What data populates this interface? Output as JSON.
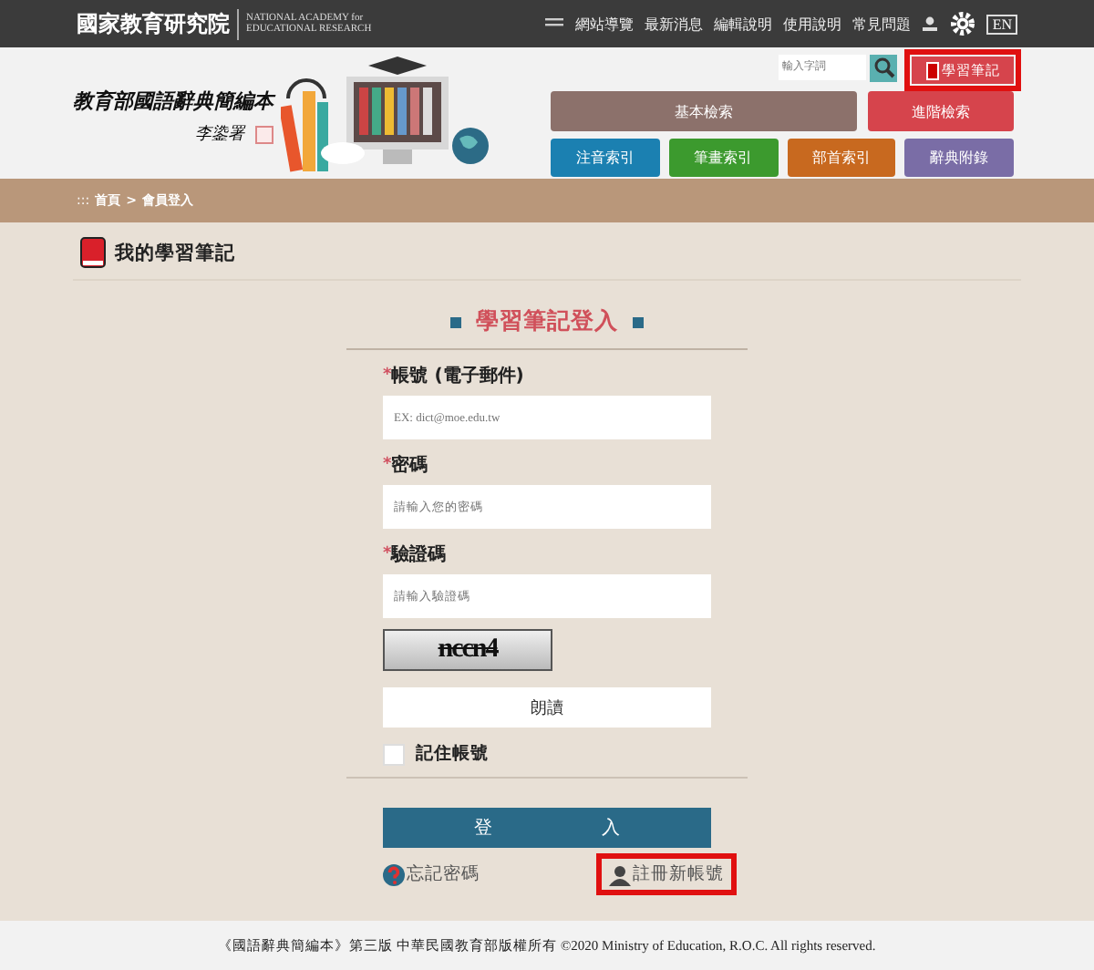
{
  "top_bar": {
    "org_name": "國家教育研究院",
    "org_english": [
      "NATIONAL ACADEMY for",
      "EDUCATIONAL RESEARCH"
    ],
    "nav": [
      "網站導覽",
      "最新消息",
      "編輯說明",
      "使用說明",
      "常見問題"
    ],
    "language": "EN"
  },
  "header": {
    "site_title": "教育部國語辭典簡編本",
    "signature": "李鍌署",
    "search": {
      "placeholder": "輸入字詞"
    },
    "notes_button": {
      "label": "學習筆記",
      "highlighted": true
    },
    "buttons": [
      {
        "label": "基本檢索",
        "color": "#8c716b"
      },
      {
        "label": "進階檢索",
        "color": "#d6444c"
      }
    ],
    "index_buttons": [
      {
        "label": "注音索引",
        "color": "#1b80b1"
      },
      {
        "label": "筆畫索引",
        "color": "#3c9a2e"
      },
      {
        "label": "部首索引",
        "color": "#c8691f"
      },
      {
        "label": "辭典附錄",
        "color": "#7a6da6"
      }
    ]
  },
  "breadcrumb_marker": ":::",
  "breadcrumb_separator": ">",
  "breadcrumb": [
    "首頁",
    "會員登入"
  ],
  "section_title": "我的學習筆記",
  "form": {
    "title": "學習筆記登入",
    "fields": [
      {
        "label": "帳號 (電子郵件)",
        "required_mark": "*",
        "placeholder": "EX: dict@moe.edu.tw"
      },
      {
        "label": "密碼",
        "required_mark": "*",
        "placeholder": "請輸入您的密碼"
      },
      {
        "label": "驗證碼",
        "required_mark": "*",
        "placeholder": "請輸入驗證碼"
      }
    ],
    "captcha": "nccn4",
    "read_aloud": "朗讀",
    "remember": {
      "label": "記住帳號",
      "checked": false
    },
    "login": [
      "登",
      "入"
    ],
    "forgot": "忘記密碼",
    "register": {
      "label": "註冊新帳號",
      "highlighted": true
    }
  },
  "footer": "《國語辭典簡編本》第三版 中華民國教育部版權所有 ©2020 Ministry of Education, R.O.C. All rights reserved."
}
